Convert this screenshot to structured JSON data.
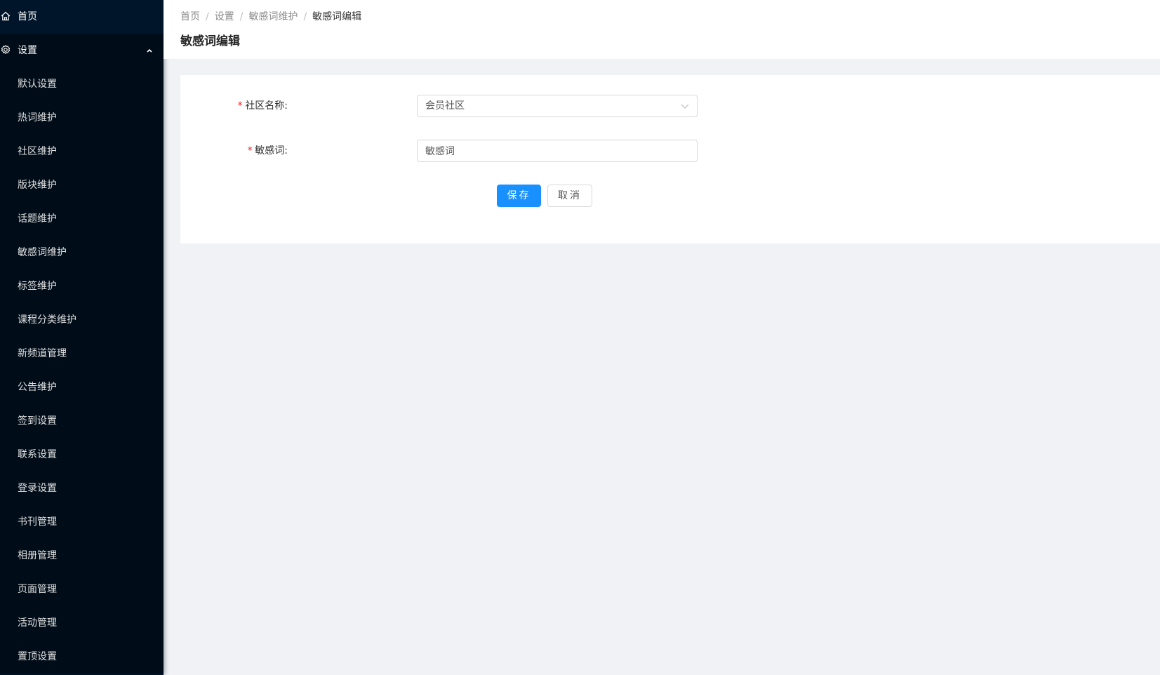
{
  "sidebar": {
    "home_label": "首页",
    "settings_label": "设置",
    "items": [
      {
        "label": "默认设置"
      },
      {
        "label": "热词维护"
      },
      {
        "label": "社区维护"
      },
      {
        "label": "版块维护"
      },
      {
        "label": "话题维护"
      },
      {
        "label": "敏感词维护"
      },
      {
        "label": "标签维护"
      },
      {
        "label": "课程分类维护"
      },
      {
        "label": "新频道管理"
      },
      {
        "label": "公告维护"
      },
      {
        "label": "签到设置"
      },
      {
        "label": "联系设置"
      },
      {
        "label": "登录设置"
      },
      {
        "label": "书刊管理"
      },
      {
        "label": "相册管理"
      },
      {
        "label": "页面管理"
      },
      {
        "label": "活动管理"
      },
      {
        "label": "置顶设置"
      }
    ]
  },
  "breadcrumb": {
    "items": [
      "首页",
      "设置",
      "敏感词维护"
    ],
    "current": "敏感词编辑",
    "separator": "/"
  },
  "page": {
    "title": "敏感词编辑"
  },
  "form": {
    "required_mark": "*",
    "community": {
      "label": "社区名称:",
      "value": "会员社区"
    },
    "keyword": {
      "label": "敏感词:",
      "value": "敏感词"
    },
    "save_label": "保存",
    "cancel_label": "取消"
  },
  "colors": {
    "sidebar_bg": "#001529",
    "submenu_bg": "#000c17",
    "primary": "#1890ff",
    "required": "#f5222d",
    "page_bg": "#f0f2f5"
  }
}
